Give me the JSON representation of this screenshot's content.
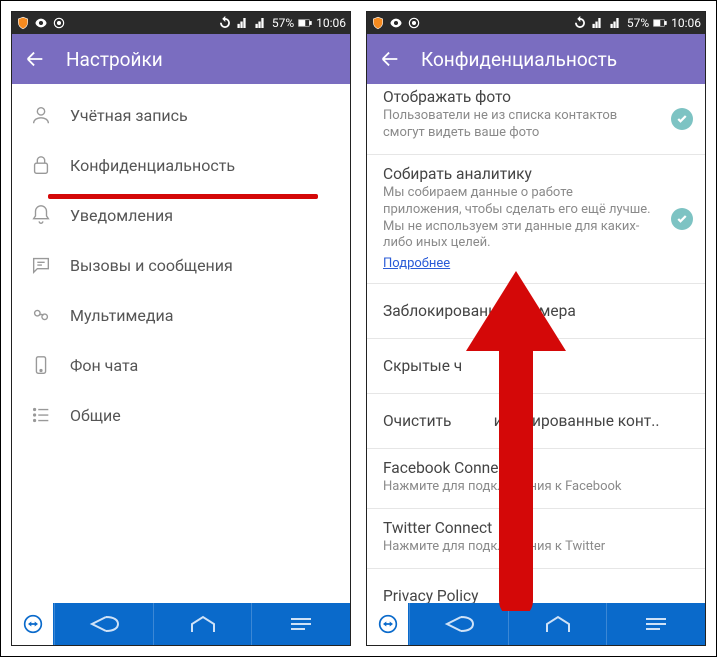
{
  "status": {
    "battery_pct": "57%",
    "time": "10:06"
  },
  "left": {
    "appbar_title": "Настройки",
    "items": [
      {
        "icon": "user",
        "label": "Учётная запись"
      },
      {
        "icon": "lock",
        "label": "Конфиденциальность"
      },
      {
        "icon": "bell",
        "label": "Уведомления"
      },
      {
        "icon": "chat",
        "label": "Вызовы и сообщения"
      },
      {
        "icon": "media",
        "label": "Мультимедиа"
      },
      {
        "icon": "phone",
        "label": "Фон чата"
      },
      {
        "icon": "list",
        "label": "Общие"
      }
    ]
  },
  "right": {
    "appbar_title": "Конфиденциальность",
    "items": [
      {
        "title": "Отображать фото",
        "sub": "Пользователи не из списка контактов смогут видеть ваше фото",
        "toggle": true
      },
      {
        "title": "Собирать аналитику",
        "sub": "Мы собираем данные о работе приложения, чтобы сделать его ещё лучше. Мы не используем эти данные для каких-либо иных целей.",
        "link": "Подробнее",
        "toggle": true
      },
      {
        "title": "Заблокированные номера"
      },
      {
        "title": "Скрытые ч"
      },
      {
        "title": "Очистить           ифицированные конт.."
      },
      {
        "title": "Facebook Connect",
        "sub": "Нажмите для подключения к Facebook"
      },
      {
        "title": "Twitter Connect",
        "sub": "Нажмите для подключения к Twitter"
      },
      {
        "title": "Privacy Policy"
      }
    ]
  }
}
